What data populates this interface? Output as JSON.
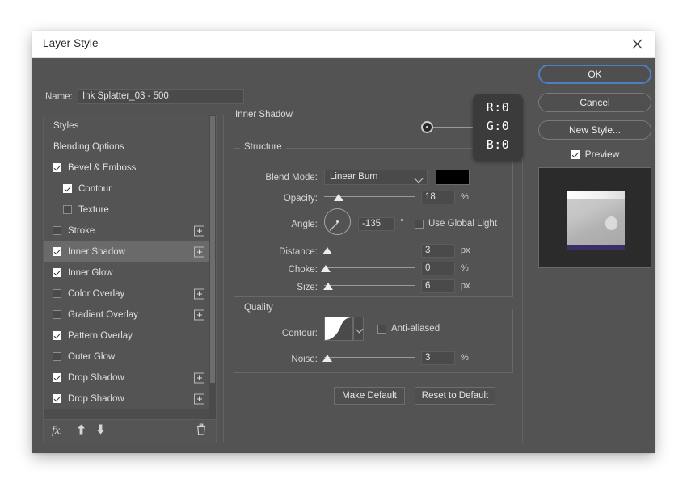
{
  "window": {
    "title": "Layer Style",
    "close_icon": "close-icon"
  },
  "name_field": {
    "label": "Name:",
    "value": "Ink Splatter_03 - 500"
  },
  "styles_list": {
    "items": [
      {
        "label": "Styles",
        "type": "header",
        "checked": null,
        "indent": false,
        "plus": false,
        "selected": false
      },
      {
        "label": "Blending Options",
        "type": "header",
        "checked": null,
        "indent": false,
        "plus": false,
        "selected": false
      },
      {
        "label": "Bevel & Emboss",
        "type": "effect",
        "checked": true,
        "indent": false,
        "plus": false,
        "selected": false
      },
      {
        "label": "Contour",
        "type": "sub",
        "checked": true,
        "indent": true,
        "plus": false,
        "selected": false
      },
      {
        "label": "Texture",
        "type": "sub",
        "checked": false,
        "indent": true,
        "plus": false,
        "selected": false
      },
      {
        "label": "Stroke",
        "type": "effect",
        "checked": false,
        "indent": false,
        "plus": true,
        "selected": false
      },
      {
        "label": "Inner Shadow",
        "type": "effect",
        "checked": true,
        "indent": false,
        "plus": true,
        "selected": true
      },
      {
        "label": "Inner Glow",
        "type": "effect",
        "checked": true,
        "indent": false,
        "plus": false,
        "selected": false
      },
      {
        "label": "Color Overlay",
        "type": "effect",
        "checked": false,
        "indent": false,
        "plus": true,
        "selected": false
      },
      {
        "label": "Gradient Overlay",
        "type": "effect",
        "checked": false,
        "indent": false,
        "plus": true,
        "selected": false
      },
      {
        "label": "Pattern Overlay",
        "type": "effect",
        "checked": true,
        "indent": false,
        "plus": false,
        "selected": false
      },
      {
        "label": "Outer Glow",
        "type": "effect",
        "checked": false,
        "indent": false,
        "plus": false,
        "selected": false
      },
      {
        "label": "Drop Shadow",
        "type": "effect",
        "checked": true,
        "indent": false,
        "plus": true,
        "selected": false
      },
      {
        "label": "Drop Shadow",
        "type": "effect",
        "checked": true,
        "indent": false,
        "plus": true,
        "selected": false
      }
    ],
    "toolbar": {
      "fx_icon": "fx-icon",
      "move_up_icon": "arrow-up-icon",
      "move_down_icon": "arrow-down-icon",
      "delete_icon": "trash-icon"
    }
  },
  "effect_panel": {
    "title": "Inner Shadow",
    "structure": {
      "title": "Structure",
      "blend_mode_label": "Blend Mode:",
      "blend_mode_value": "Linear Burn",
      "color_swatch": "#000000",
      "opacity_label": "Opacity:",
      "opacity_value": "18",
      "opacity_unit": "%",
      "opacity_percent": 18,
      "angle_label": "Angle:",
      "angle_value": "-135",
      "angle_unit": "°",
      "use_global_light_label": "Use Global Light",
      "use_global_light_checked": false,
      "distance_label": "Distance:",
      "distance_value": "3",
      "distance_unit": "px",
      "distance_percent": 3,
      "choke_label": "Choke:",
      "choke_value": "0",
      "choke_unit": "%",
      "choke_percent": 0,
      "size_label": "Size:",
      "size_value": "6",
      "size_unit": "px",
      "size_percent": 4
    },
    "quality": {
      "title": "Quality",
      "contour_label": "Contour:",
      "anti_aliased_label": "Anti-aliased",
      "anti_aliased_checked": false,
      "noise_label": "Noise:",
      "noise_value": "3",
      "noise_unit": "%",
      "noise_percent": 3
    },
    "make_default_label": "Make Default",
    "reset_default_label": "Reset to Default"
  },
  "right_column": {
    "ok_label": "OK",
    "cancel_label": "Cancel",
    "new_style_label": "New Style...",
    "preview_label": "Preview",
    "preview_checked": true
  },
  "color_readout": {
    "r": "R:0",
    "g": "G:0",
    "b": "B:0"
  },
  "colors": {
    "dialog_bg": "#535353",
    "accent": "#4d7fc4",
    "selected_row": "#6a6a6a"
  }
}
